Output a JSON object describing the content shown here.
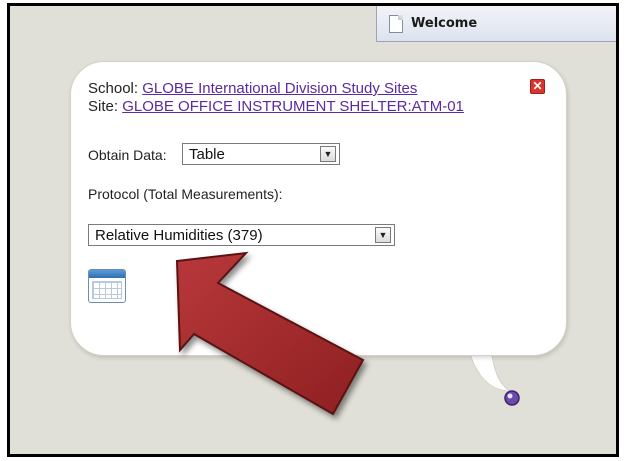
{
  "tab": {
    "label": "Welcome",
    "icon": "document-icon"
  },
  "popup": {
    "school_label": "School:",
    "school_value": "GLOBE International Division Study Sites",
    "site_label": "Site:",
    "site_value": "GLOBE OFFICE INSTRUMENT SHELTER:ATM-01",
    "close_icon": "close-icon",
    "obtain_data_label": "Obtain Data:",
    "obtain_data_value": "Table",
    "protocol_label": "Protocol (Total Measurements):",
    "protocol_value": "Relative Humidities (379)",
    "table_icon": "table-icon"
  },
  "colors": {
    "background": "#e1e0d8",
    "link": "#5c2a9e",
    "close": "#d9342e",
    "arrow": "#a1282a",
    "marker": "#6b4aa8"
  }
}
